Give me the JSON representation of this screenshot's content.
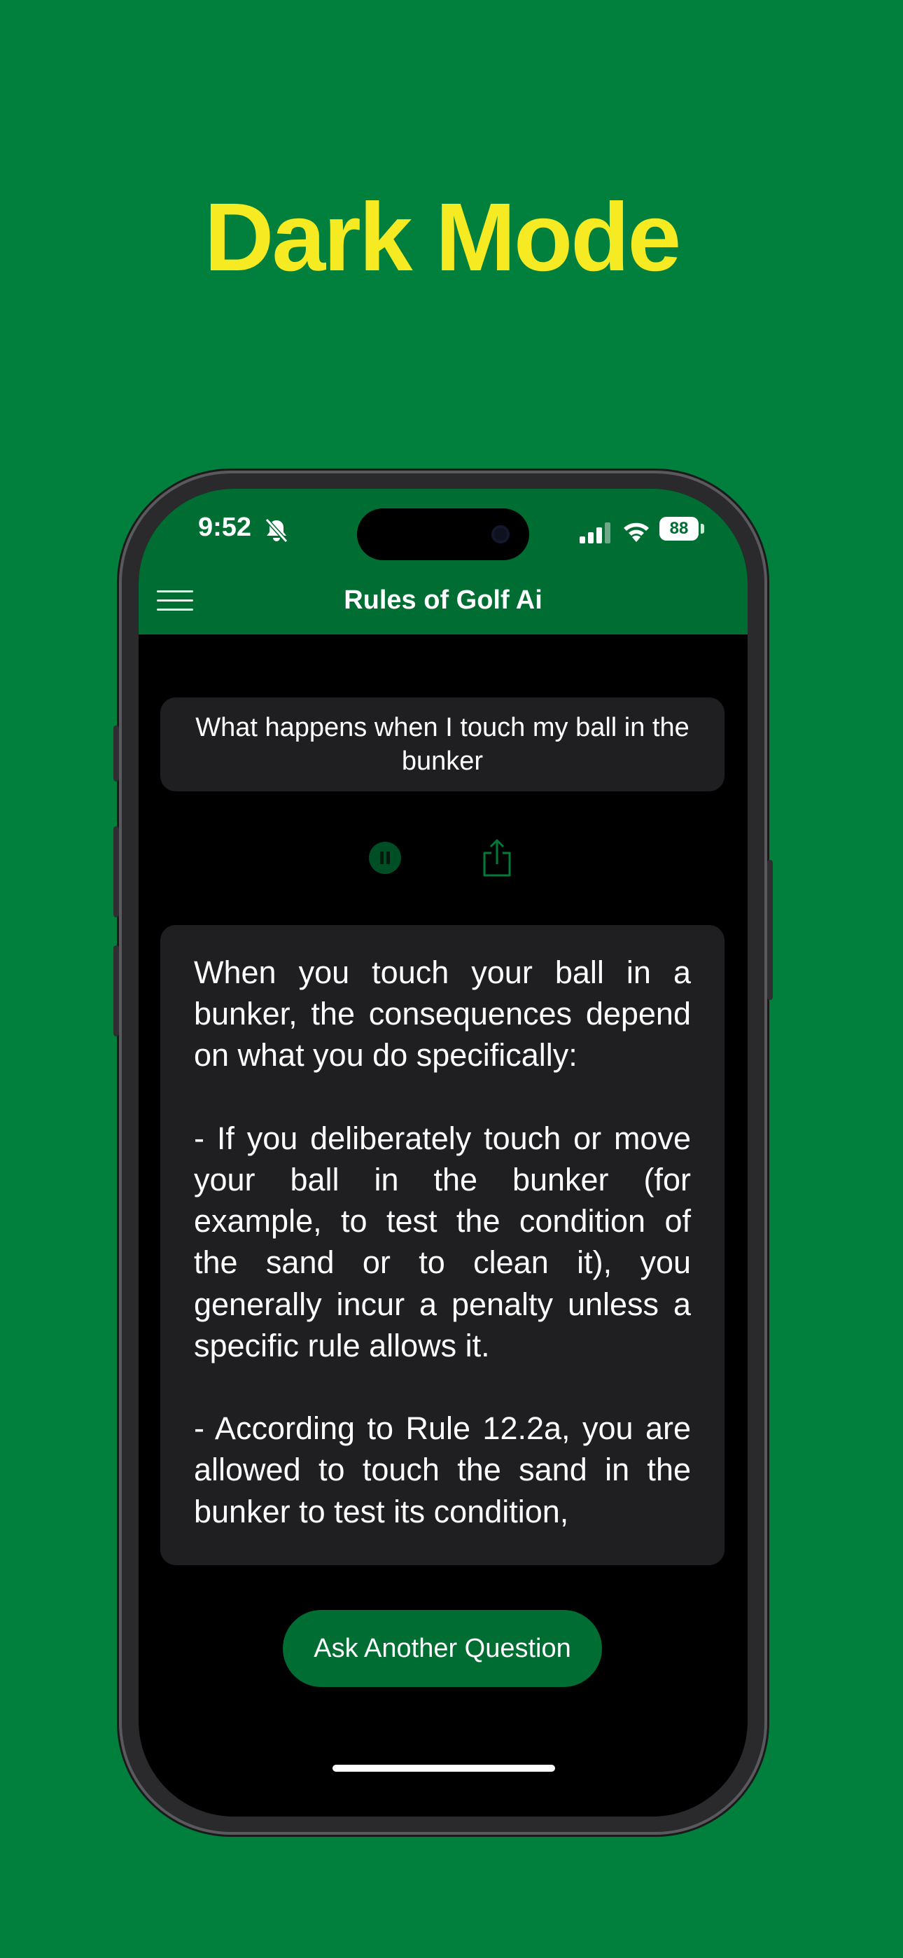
{
  "headline": "Dark Mode",
  "status_bar": {
    "time": "9:52",
    "battery": "88",
    "icons": [
      "bell-slash-icon",
      "cellular-signal-icon",
      "wifi-icon",
      "battery-icon"
    ]
  },
  "app": {
    "title": "Rules of Golf Ai",
    "menu_icon": "hamburger-menu-icon"
  },
  "question": "What happens when I touch my ball in the bunker",
  "controls": {
    "pause_icon": "pause-icon",
    "share_icon": "share-icon"
  },
  "answer": "When you touch your ball in a bunker, the consequences depend on what you do specifically:\n\n- If you deliberately touch or move your ball in the bunker (for example, to test the condition of the sand or to clean it), you generally incur a penalty unless a specific rule allows it.\n\n- According to Rule 12.2a, you are allowed to touch the sand in the bunker to test its condition,",
  "ask_button": "Ask Another Question",
  "colors": {
    "background": "#017f3d",
    "headline": "#f6ea22",
    "header": "#006d33",
    "card": "#1f1f21",
    "screen": "#000000"
  }
}
